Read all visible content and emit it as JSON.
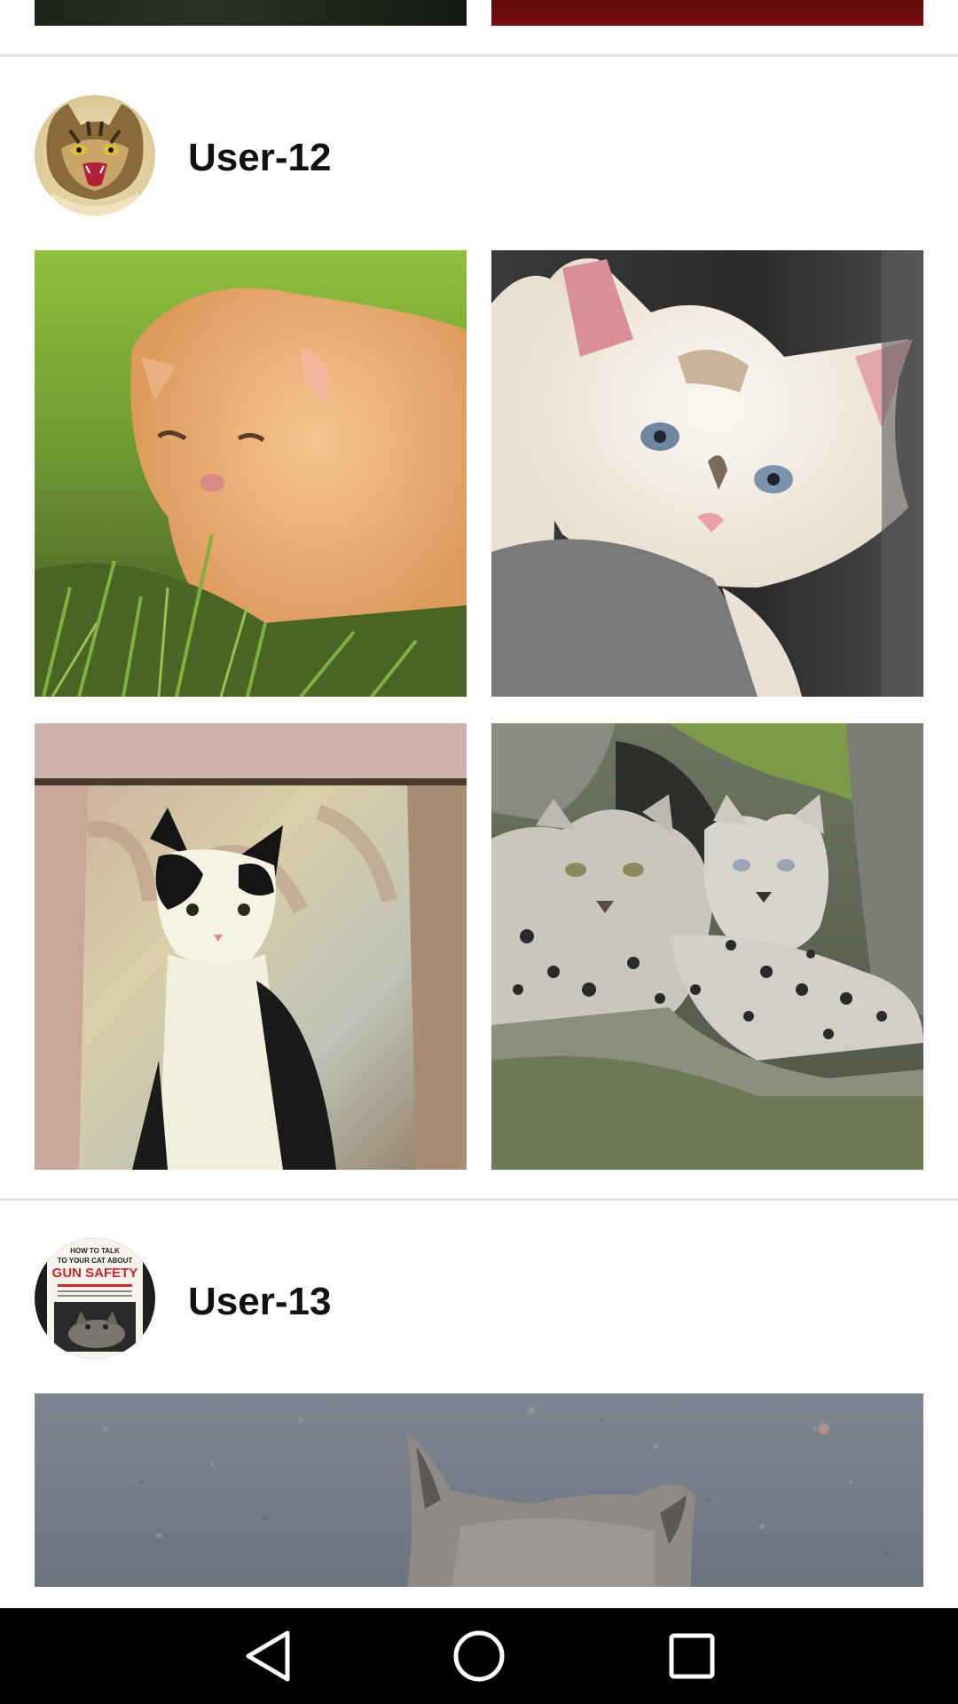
{
  "feed": {
    "posts": [
      {
        "username": "User-12",
        "avatar": "cat-avatar-open-mouth",
        "photos": [
          "orange-kitten-in-grass",
          "white-fluffy-cat",
          "black-white-cat-curtain",
          "snow-leopards"
        ]
      },
      {
        "username": "User-13",
        "avatar": "gun-safety-poster-avatar",
        "avatar_poster": {
          "line1": "HOW TO TALK",
          "line2": "TO YOUR CAT ABOUT",
          "line3": "GUN SAFETY"
        },
        "photos": [
          "gray-cat-on-asphalt"
        ]
      }
    ]
  },
  "navbar": {
    "back_icon": "triangle-back-icon",
    "home_icon": "circle-home-icon",
    "recents_icon": "square-recents-icon"
  },
  "colors": {
    "background": "#ffffff",
    "divider": "#e2e2e2",
    "username_text": "#111111",
    "navbar": "#000000"
  }
}
